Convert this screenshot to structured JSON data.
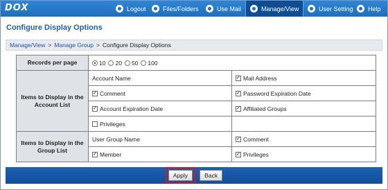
{
  "brand": {
    "logo_text": "DOX"
  },
  "nav": {
    "items": [
      {
        "label": "Logout",
        "icon": "logout-icon"
      },
      {
        "label": "Files/Folders",
        "icon": "folder-icon"
      },
      {
        "label": "Use Mail",
        "icon": "mail-icon"
      },
      {
        "label": "Manage/View",
        "icon": "manage-icon",
        "active": true
      },
      {
        "label": "User Setting",
        "icon": "user-icon"
      },
      {
        "label": "Help",
        "icon": "help-icon"
      }
    ]
  },
  "page": {
    "title": "Configure Display Options"
  },
  "breadcrumb": {
    "link1": "Manage/View",
    "link2": "Manage Group",
    "current": "Configure Display Options",
    "sep": ">"
  },
  "records": {
    "header": "Records per page",
    "options": [
      "10",
      "20",
      "50",
      "100"
    ],
    "selected": "10"
  },
  "account_list": {
    "header": "Items to Display in the Account List",
    "fixed_item": "Account Name",
    "items": [
      {
        "label": "Mail Address",
        "checked": true
      },
      {
        "label": "Comment",
        "checked": true
      },
      {
        "label": "Password Expiration Date",
        "checked": true
      },
      {
        "label": "Account Expiration Date",
        "checked": true
      },
      {
        "label": "Affiliated Groups",
        "checked": true
      },
      {
        "label": "Privileges",
        "checked": false
      }
    ]
  },
  "group_list": {
    "header": "Items to Display in the Group List",
    "fixed_item": "User Group Name",
    "items": [
      {
        "label": "Comment",
        "checked": true
      },
      {
        "label": "Member",
        "checked": true
      },
      {
        "label": "Privileges",
        "checked": true
      }
    ]
  },
  "actions": {
    "apply_label": "Apply",
    "back_label": "Back"
  },
  "colors": {
    "nav_bg": "#1f6fbe",
    "active_tab": "#0f4d92",
    "title": "#1f5fa6",
    "highlight": "#d3161c"
  }
}
